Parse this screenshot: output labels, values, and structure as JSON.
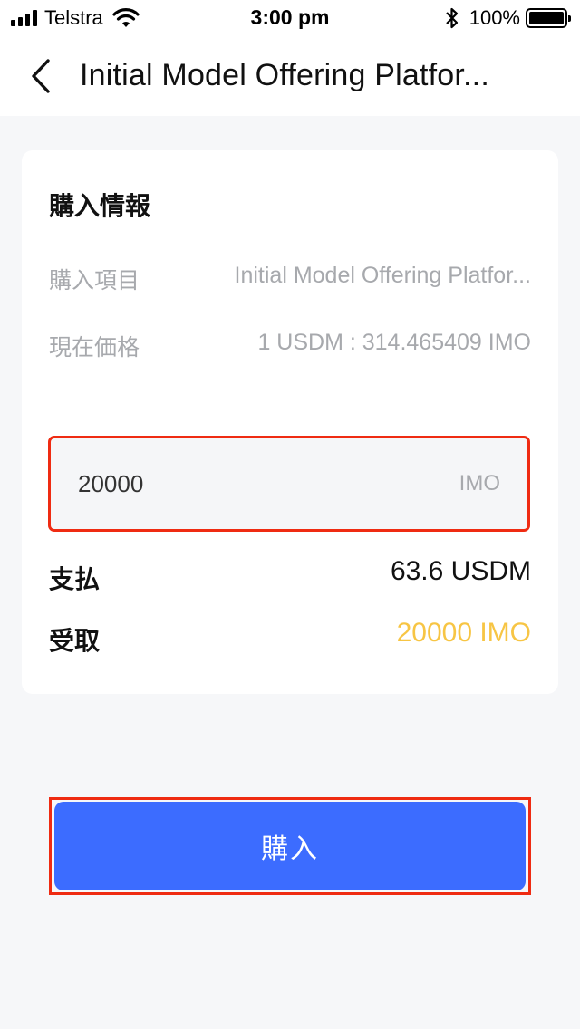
{
  "status_bar": {
    "carrier": "Telstra",
    "time": "3:00 pm",
    "battery": "100%"
  },
  "nav": {
    "title": "Initial Model Offering Platfor..."
  },
  "card": {
    "title": "購入情報",
    "item_label": "購入項目",
    "item_value": "Initial Model Offering Platfor...",
    "price_label": "現在価格",
    "price_value": "1 USDM : 314.465409 IMO",
    "amount_value": "20000",
    "amount_unit": "IMO",
    "pay_label": "支払",
    "pay_value": "63.6 USDM",
    "receive_label": "受取",
    "receive_value": "20000 IMO"
  },
  "buy_button": {
    "label": "購入"
  },
  "colors": {
    "accent": "#3c6cff",
    "receive": "#f7c544",
    "highlight": "#ef2b12"
  }
}
